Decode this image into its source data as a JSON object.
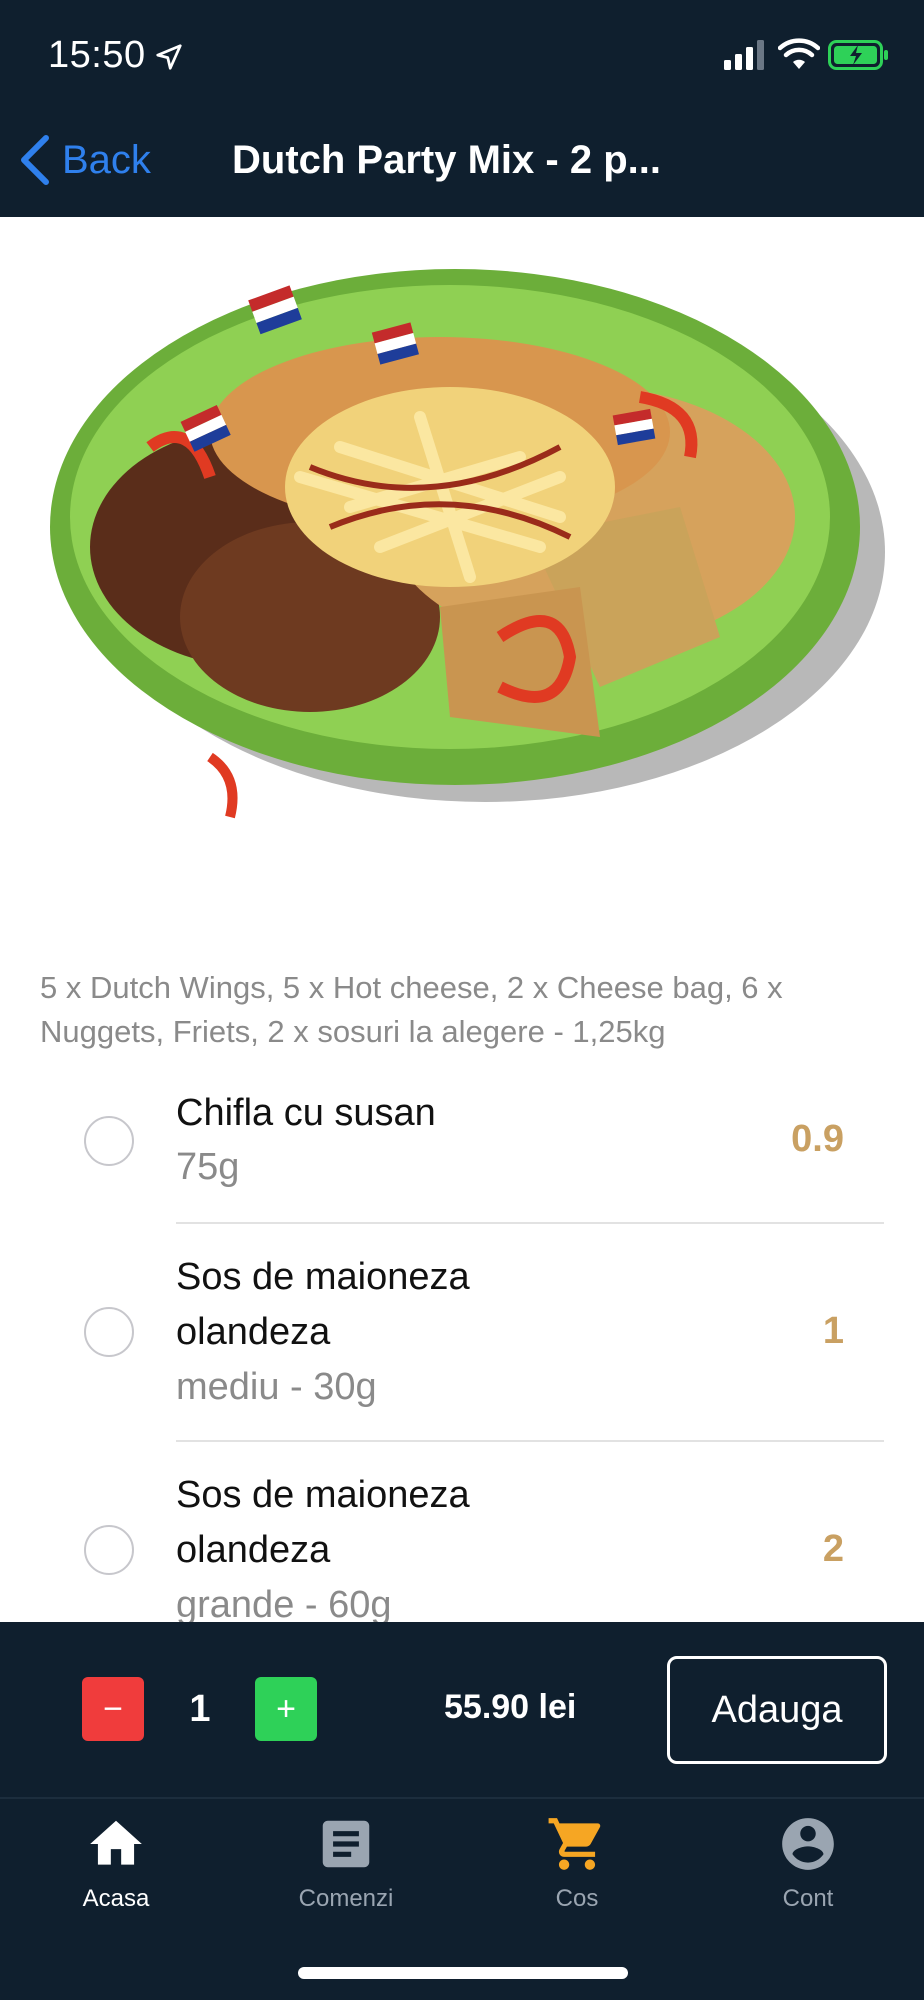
{
  "status_bar": {
    "time": "15:50"
  },
  "nav": {
    "back_label": "Back",
    "title": "Dutch Party Mix - 2 p..."
  },
  "product": {
    "description": "5 x Dutch Wings, 5 x Hot cheese, 2 x Cheese bag, 6 x Nuggets, Friets, 2 x sosuri la alegere - 1,25kg"
  },
  "options": [
    {
      "name_line1": "Chifla cu susan",
      "name_line2": "",
      "detail": "75g",
      "price": "0.9",
      "selected": false
    },
    {
      "name_line1": "Sos de maioneza",
      "name_line2": "olandeza",
      "detail": "mediu - 30g",
      "price": "1",
      "selected": false
    },
    {
      "name_line1": "Sos de maioneza",
      "name_line2": "olandeza",
      "detail": "grande - 60g",
      "price": "2",
      "selected": false
    }
  ],
  "cart": {
    "minus_label": "−",
    "quantity": "1",
    "plus_label": "+",
    "total": "55.90 lei",
    "add_label": "Adauga"
  },
  "tabs": [
    {
      "label": "Acasa",
      "icon": "home-icon",
      "active": true
    },
    {
      "label": "Comenzi",
      "icon": "orders-icon",
      "active": false
    },
    {
      "label": "Cos",
      "icon": "cart-icon",
      "active": false
    },
    {
      "label": "Cont",
      "icon": "account-icon",
      "active": false
    }
  ],
  "colors": {
    "header_bg": "#0f1f2e",
    "back_blue": "#2f80ed",
    "price_gold": "#c9a062",
    "minus_red": "#f03c3c",
    "plus_green": "#2ed158",
    "cart_orange": "#f6a623",
    "tab_inactive": "#9aa5b1"
  }
}
